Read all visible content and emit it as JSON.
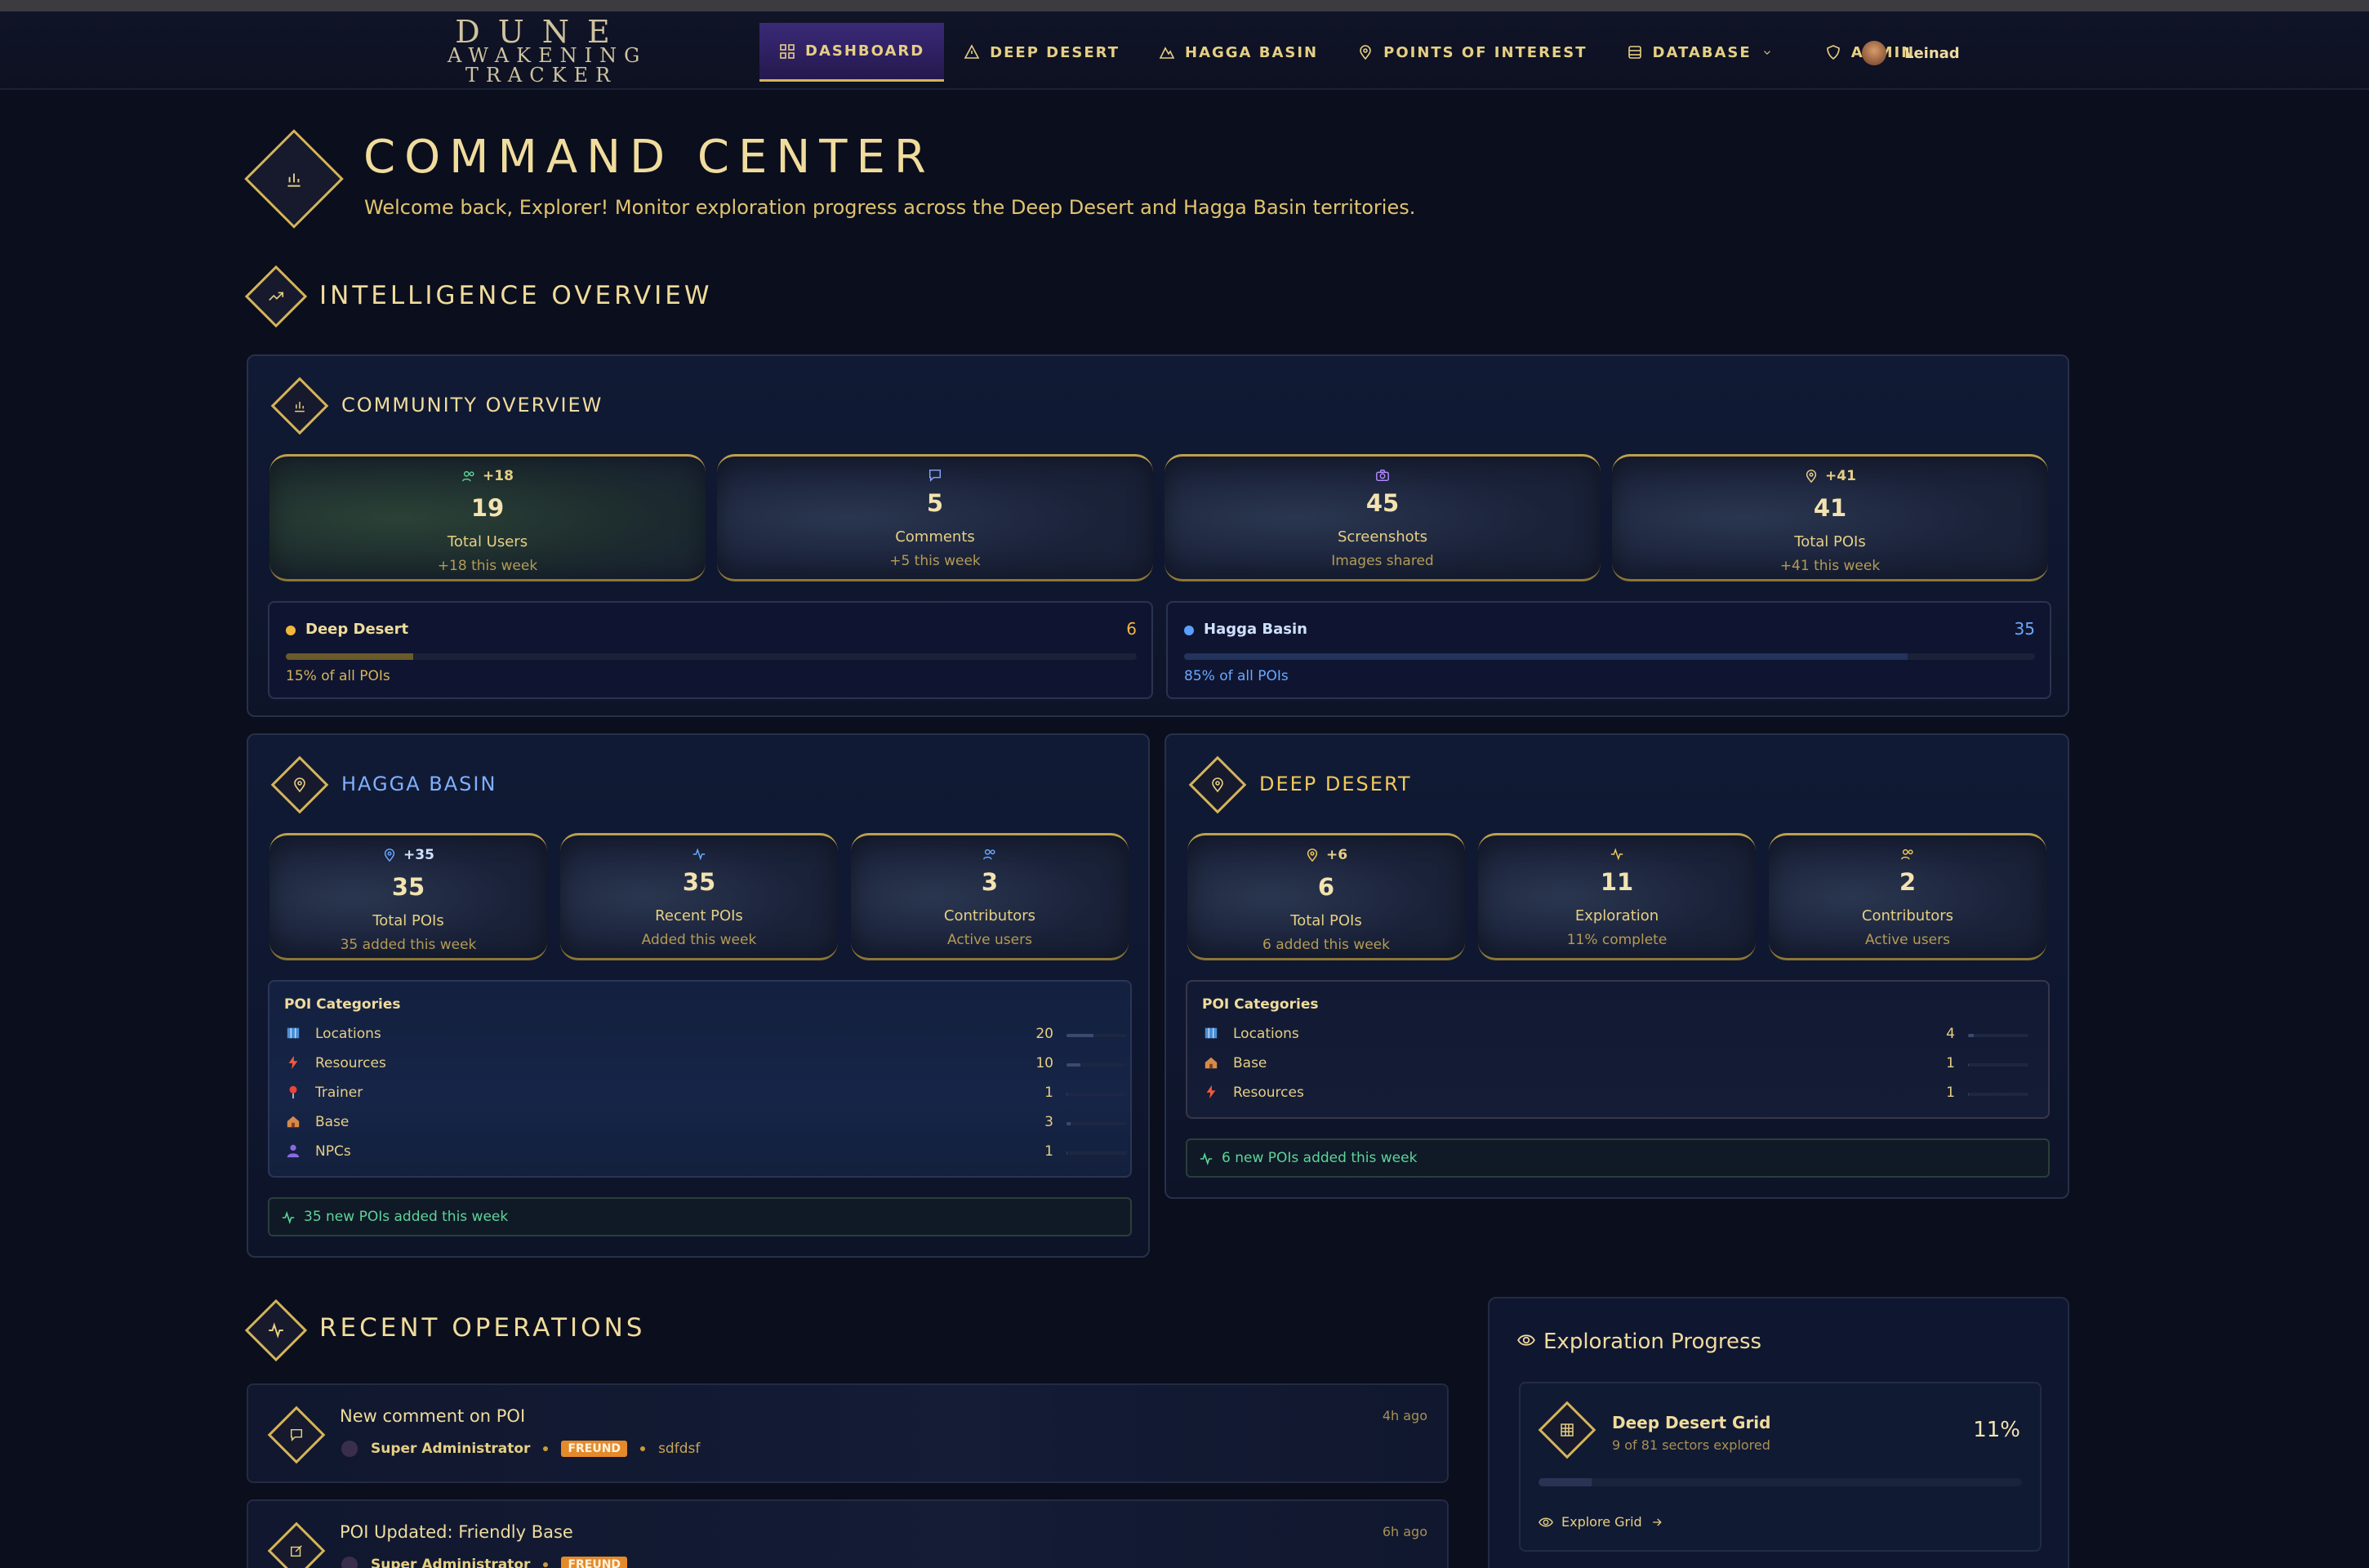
{
  "app": {
    "logo": {
      "line1": "DUNE",
      "line2": "AWAKENING",
      "line3": "TRACKER"
    },
    "nav": [
      {
        "label": "DASHBOARD",
        "icon": "grid-icon",
        "active": true
      },
      {
        "label": "DEEP DESERT",
        "icon": "warning-icon"
      },
      {
        "label": "HAGGA BASIN",
        "icon": "mountain-icon"
      },
      {
        "label": "POINTS OF INTEREST",
        "icon": "map-pin-icon"
      },
      {
        "label": "DATABASE",
        "icon": "database-icon"
      },
      {
        "label": "ADMIN",
        "icon": "shield-icon"
      }
    ],
    "user": {
      "name": "Leinad"
    }
  },
  "header": {
    "title": "COMMAND CENTER",
    "subtitle": "Welcome back, Explorer! Monitor exploration progress across the Deep Desert and Hagga Basin territories."
  },
  "intel": {
    "title": "INTELLIGENCE OVERVIEW",
    "community": {
      "title": "COMMUNITY OVERVIEW",
      "stats": [
        {
          "badge": "+18",
          "value": "19",
          "label": "Total Users",
          "sub": "+18 this week",
          "icon": "users-icon"
        },
        {
          "badge": "",
          "value": "5",
          "label": "Comments",
          "sub": "+5 this week",
          "icon": "comment-icon"
        },
        {
          "badge": "",
          "value": "45",
          "label": "Screenshots",
          "sub": "Images shared",
          "icon": "camera-icon"
        },
        {
          "badge": "+41",
          "value": "41",
          "label": "Total POIs",
          "sub": "+41 this week",
          "icon": "map-pin-icon"
        }
      ],
      "regions": [
        {
          "name": "Deep Desert",
          "count": "6",
          "pct_text": "15% of all POIs",
          "fraction": 0.15,
          "color": "#f2b63c"
        },
        {
          "name": "Hagga Basin",
          "count": "35",
          "pct_text": "85% of all POIs",
          "fraction": 0.85,
          "color": "#5aa0ff"
        }
      ]
    },
    "hagga": {
      "title": "HAGGA BASIN",
      "stats": [
        {
          "badge": "+35",
          "value": "35",
          "label": "Total POIs",
          "sub": "35 added this week"
        },
        {
          "badge": "",
          "value": "35",
          "label": "Recent POIs",
          "sub": "Added this week"
        },
        {
          "badge": "",
          "value": "3",
          "label": "Contributors",
          "sub": "Active users"
        }
      ],
      "categories_title": "POI Categories",
      "categories": [
        {
          "name": "Locations",
          "count": "20",
          "icon": "map-icon",
          "fraction": 0.45
        },
        {
          "name": "Resources",
          "count": "10",
          "icon": "lightning-icon",
          "fraction": 0.23
        },
        {
          "name": "Trainer",
          "count": "1",
          "icon": "pushpin-icon",
          "fraction": 0.02
        },
        {
          "name": "Base",
          "count": "3",
          "icon": "house-icon",
          "fraction": 0.07
        },
        {
          "name": "NPCs",
          "count": "1",
          "icon": "person-icon",
          "fraction": 0.02
        }
      ],
      "weekly": "35 new POIs added this week"
    },
    "deep": {
      "title": "DEEP DESERT",
      "stats": [
        {
          "badge": "+6",
          "value": "6",
          "label": "Total POIs",
          "sub": "6 added this week"
        },
        {
          "badge": "",
          "value": "11",
          "label": "Exploration",
          "sub": "11% complete"
        },
        {
          "badge": "",
          "value": "2",
          "label": "Contributors",
          "sub": "Active users"
        }
      ],
      "categories_title": "POI Categories",
      "categories": [
        {
          "name": "Locations",
          "count": "4",
          "icon": "map-icon",
          "fraction": 0.1
        },
        {
          "name": "Base",
          "count": "1",
          "icon": "house-icon",
          "fraction": 0.02
        },
        {
          "name": "Resources",
          "count": "1",
          "icon": "lightning-icon",
          "fraction": 0.02
        }
      ],
      "weekly": "6 new POIs added this week"
    }
  },
  "operations": {
    "title": "RECENT OPERATIONS",
    "items": [
      {
        "title": "New comment on POI",
        "time": "4h ago",
        "user": "Super Administrator",
        "tag": "FREUND",
        "extra": "sdfdsf",
        "icon": "comment-icon"
      },
      {
        "title": "POI Updated: Friendly Base",
        "time": "6h ago",
        "user": "Super Administrator",
        "tag": "FREUND",
        "extra": "",
        "icon": "edit-icon"
      }
    ]
  },
  "exploration": {
    "title": "Exploration Progress",
    "grid_name": "Deep Desert Grid",
    "grid_sub": "9 of 81 sectors explored",
    "grid_pct": "11%",
    "fraction": 0.11,
    "link": "Explore Grid"
  }
}
